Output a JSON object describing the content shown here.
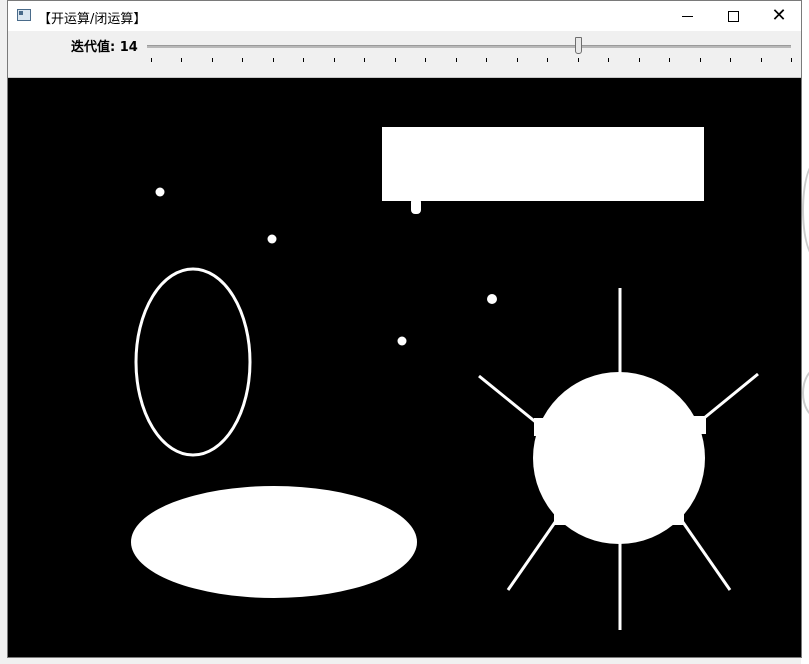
{
  "window": {
    "title": "【开运算/闭运算】",
    "minimize_label": "",
    "maximize_label": "",
    "close_label": "✕"
  },
  "toolbar": {
    "slider_label": "迭代值: 14",
    "slider_value": 14,
    "slider_fraction": 0.67
  },
  "canvas": {
    "background": "#000000",
    "foreground": "#ffffff"
  },
  "colors": {
    "title_bg": "#ffffff",
    "toolbar_bg": "#f0f0f0",
    "track": "#b8b8b8"
  },
  "icons": {
    "app": "window-app-icon",
    "minimize": "minimize-icon",
    "maximize": "maximize-icon",
    "close": "close-icon"
  }
}
